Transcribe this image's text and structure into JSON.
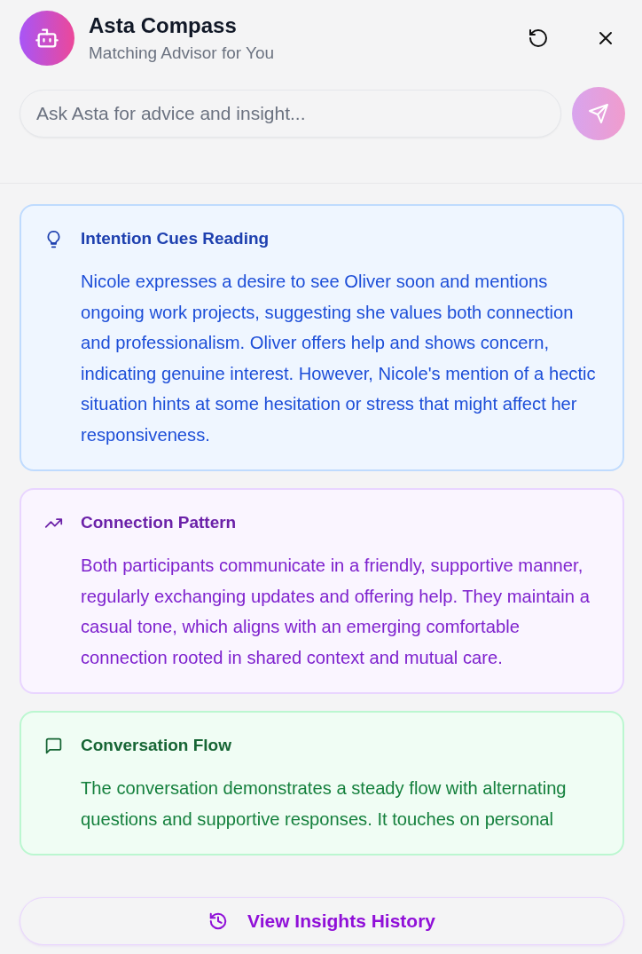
{
  "header": {
    "title": "Asta Compass",
    "subtitle": "Matching Advisor for You"
  },
  "ask": {
    "placeholder": "Ask Asta for advice and insight..."
  },
  "cards": [
    {
      "kind": "intention",
      "title": "Intention Cues Reading",
      "text": "Nicole expresses a desire to see Oliver soon and mentions ongoing work projects, suggesting she values both connection and professionalism. Oliver offers help and shows concern, indicating genuine interest. However, Nicole's mention of a hectic situation hints at some hesitation or stress that might affect her responsiveness."
    },
    {
      "kind": "pattern",
      "title": "Connection Pattern",
      "text": "Both participants communicate in a friendly, supportive manner, regularly exchanging updates and offering help. They maintain a casual tone, which aligns with an emerging comfortable connection rooted in shared context and mutual care."
    },
    {
      "kind": "flow",
      "title": "Conversation Flow",
      "text": "The conversation demonstrates a steady flow with alternating questions and supportive responses. It touches on personal"
    }
  ],
  "footer": {
    "label": "View Insights History"
  }
}
